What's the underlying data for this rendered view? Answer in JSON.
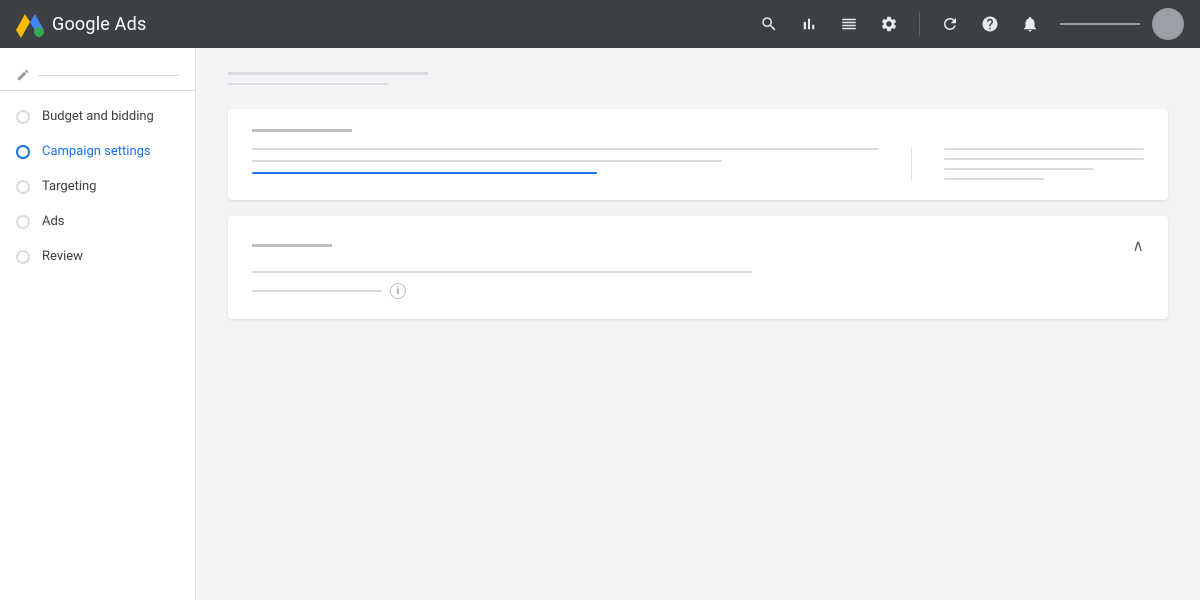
{
  "header": {
    "logo_text": "Google Ads",
    "icons": [
      "search",
      "bar-chart",
      "settings-alt",
      "settings",
      "refresh",
      "help",
      "bell"
    ]
  },
  "sidebar": {
    "search_placeholder": "",
    "nav_items": [
      {
        "id": "budget",
        "label": "Budget and bidding",
        "active": false
      },
      {
        "id": "campaign",
        "label": "Campaign settings",
        "active": true
      },
      {
        "id": "targeting",
        "label": "Targeting",
        "active": false
      },
      {
        "id": "ads",
        "label": "Ads",
        "active": false
      },
      {
        "id": "review",
        "label": "Review",
        "active": false
      }
    ]
  },
  "main": {
    "page_title": "",
    "page_subtitle": "",
    "card1": {
      "title": "",
      "left_lines": [
        "full",
        "three-quarter",
        "blue"
      ],
      "right_lines": [
        "full",
        "full",
        "three-quarter",
        "half"
      ]
    },
    "card2": {
      "title": "",
      "field1_lines": [
        "three-quarter"
      ],
      "field2_lines": [
        "half"
      ]
    }
  },
  "icons": {
    "search": "🔍",
    "bar_chart": "📊",
    "settings_alt": "⚙",
    "refresh": "↺",
    "help": "?",
    "bell": "🔔",
    "chevron_up": "∧",
    "info": "i",
    "edit": "✏"
  }
}
